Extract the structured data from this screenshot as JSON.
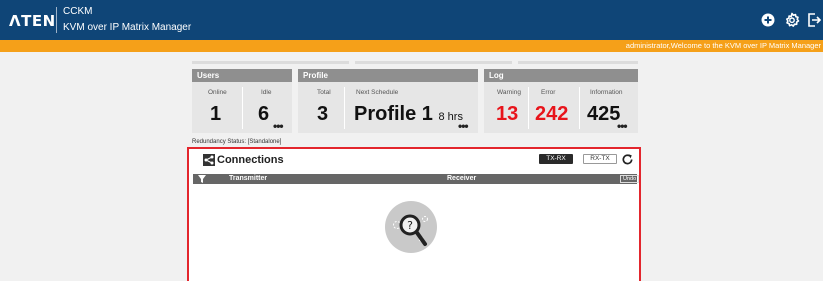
{
  "header": {
    "logo": "ΛTEN",
    "app_name": "CCKM",
    "app_subtitle": "KVM over IP Matrix Manager",
    "icons": [
      "add-icon",
      "gear-icon",
      "logout-icon"
    ]
  },
  "welcome": "administrator,Welcome to the KVM over IP Matrix Manager",
  "panels": {
    "users": {
      "title": "Users",
      "online_label": "Online",
      "online_value": "1",
      "idle_label": "Idle",
      "idle_value": "6",
      "more": "•••"
    },
    "profile": {
      "title": "Profile",
      "total_label": "Total",
      "total_value": "3",
      "next_label": "Next Schedule",
      "next_value": "Profile 1",
      "next_time": "8 hrs",
      "more": "•••"
    },
    "log": {
      "title": "Log",
      "warning_label": "Warning",
      "warning_value": "13",
      "error_label": "Error",
      "error_value": "242",
      "info_label": "Information",
      "info_value": "425",
      "more": "•••"
    }
  },
  "redundancy": "Redundancy Status: [Standalone]",
  "connections": {
    "title": "Connections",
    "btn_txrx": "TX-RX",
    "btn_rxtx": "RX-TX",
    "col_transmitter": "Transmitter",
    "col_receiver": "Receiver",
    "undo": "Undo"
  },
  "colors": {
    "header_bg": "#0f4577",
    "welcome_bg": "#f5a019",
    "alert_red": "#e8141b",
    "border_red": "#e3262d"
  }
}
